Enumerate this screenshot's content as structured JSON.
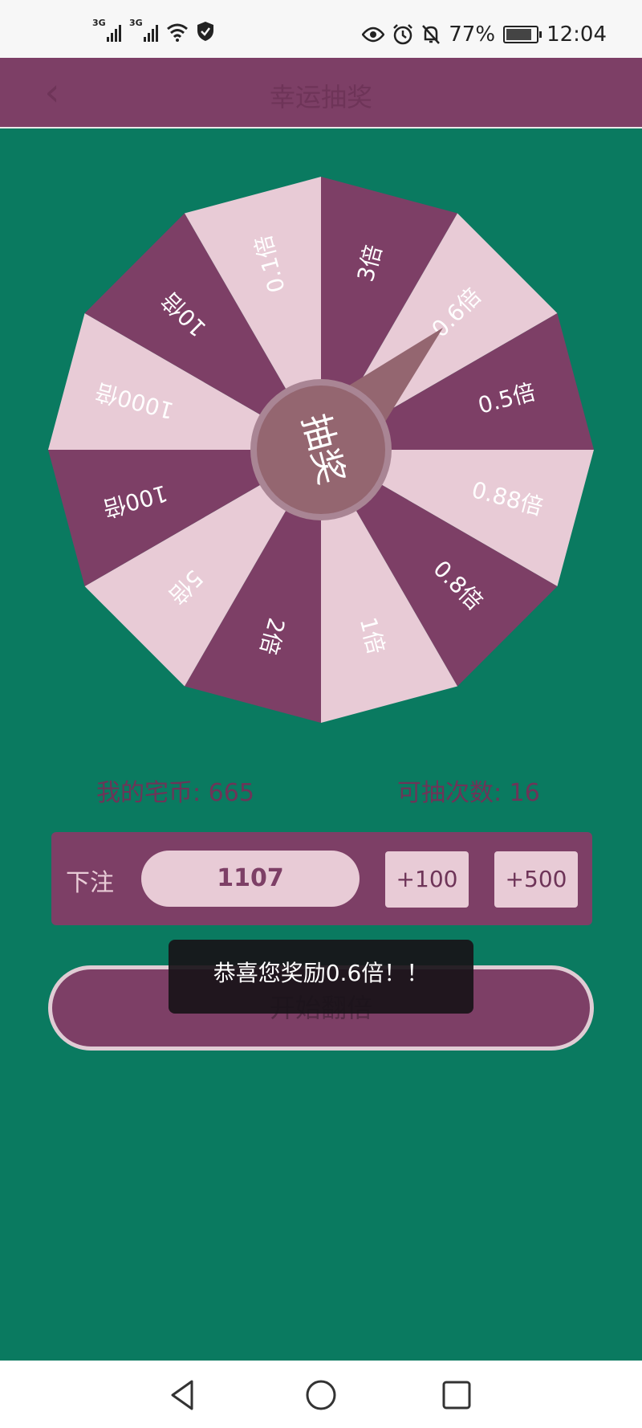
{
  "status_bar": {
    "signal1_label": "3G",
    "signal2_label": "3G",
    "battery_text": "77%",
    "time": "12:04"
  },
  "app_bar": {
    "title": "幸运抽奖"
  },
  "wheel": {
    "segments": [
      "3倍",
      "0.6倍",
      "0.5倍",
      "0.88倍",
      "0.8倍",
      "1倍",
      "2倍",
      "5倍",
      "100倍",
      "1000倍",
      "10倍",
      "0.1倍"
    ],
    "center_label": "抽奖",
    "pointer_segment": "0.6倍",
    "colors": {
      "dark": "#7d3f66",
      "light": "#e8cbd6",
      "center": "#946670",
      "center_ring": "#a98594",
      "pointer": "#946670"
    }
  },
  "info": {
    "coins_text": "我的宅币: 665",
    "draws_text": "可抽次数: 16"
  },
  "bet": {
    "label": "下注",
    "value": "1107",
    "add100_label": "+100",
    "add500_label": "+500"
  },
  "start_button_label": "开始翻倍",
  "toast_text": "恭喜您奖励0.6倍！！",
  "colors": {
    "background": "#0a7a60",
    "primary": "#7d3f66",
    "accent_light": "#e8cbd6"
  },
  "nav_icons": [
    "back-triangle-icon",
    "home-circle-icon",
    "recents-square-icon"
  ]
}
